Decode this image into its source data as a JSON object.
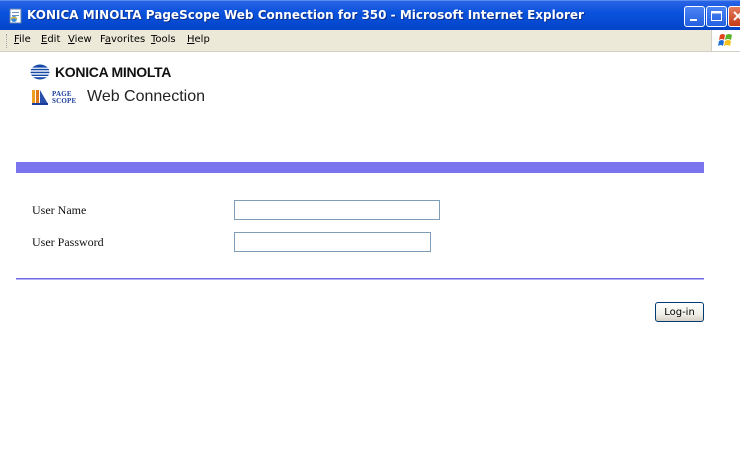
{
  "window": {
    "title": "KONICA MINOLTA PageScope Web Connection for 350 - Microsoft Internet Explorer"
  },
  "menu": {
    "items": [
      {
        "label": "File",
        "accel": "F",
        "rest": "ile"
      },
      {
        "label": "Edit",
        "accel": "E",
        "rest": "dit"
      },
      {
        "label": "View",
        "accel": "V",
        "rest": "iew"
      },
      {
        "label": "Favorites",
        "accel": "a",
        "pre": "F",
        "rest": "vorites"
      },
      {
        "label": "Tools",
        "accel": "T",
        "rest": "ools"
      },
      {
        "label": "Help",
        "accel": "H",
        "rest": "elp"
      }
    ]
  },
  "header": {
    "brand": "KONICA MINOLTA",
    "pagescope_small_top": "PAGE",
    "pagescope_small_bottom": "SCOPE",
    "product": "Web Connection"
  },
  "form": {
    "user_name_label": "User Name",
    "user_name_value": "",
    "user_password_label": "User Password",
    "user_password_value": "",
    "login_label": "Log-in"
  },
  "colors": {
    "accent_bar": "#7b74ef",
    "titlebar": "#0a52dd"
  }
}
